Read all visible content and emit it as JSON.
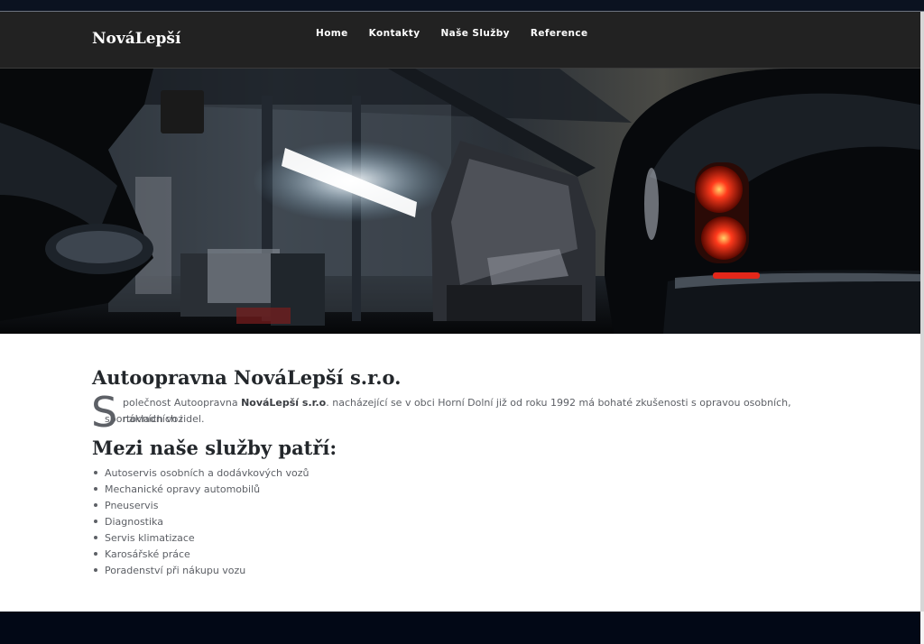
{
  "brand": "NováLepší",
  "nav": {
    "home": "Home",
    "kontakty": "Kontakty",
    "sluzby": "Naše Služby",
    "reference": "Reference"
  },
  "hero": {
    "alt": "Garage with classic car"
  },
  "about": {
    "title": "Autoopravna NováLepší s.r.o.",
    "dropcap": "S",
    "text_before": "polečnost Autoopravna ",
    "company": "NováLepší s.r.o",
    "text_after": ". nacházející se v obci Horní Dolní již od roku 1992 má bohaté zkušenosti s opravou osobních, nákladních i",
    "text_line2": "sportovních vozidel."
  },
  "services": {
    "title": "Mezi naše služby patří:",
    "items": [
      "Autoservis osobních a dodávkových vozů",
      "Mechanické opravy automobilů",
      "Pneuservis",
      "Diagnostika",
      "Servis klimatizace",
      "Karosářské práce",
      "Poradenství při nákupu vozu"
    ]
  }
}
